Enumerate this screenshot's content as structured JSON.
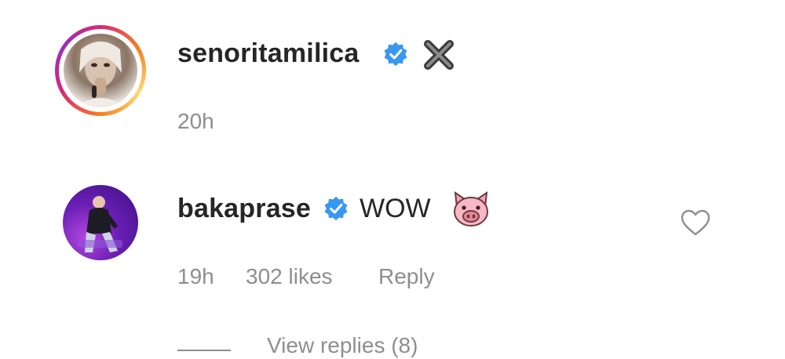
{
  "comments": [
    {
      "username": "senoritamilica",
      "verified": true,
      "text_icon": "heavy-multiplication-x-emoji",
      "time": "20h"
    },
    {
      "username": "bakaprase",
      "verified": true,
      "text": "WOW",
      "text_icon": "pig-face-emoji",
      "time": "19h",
      "likes": "302 likes",
      "reply_label": "Reply"
    }
  ],
  "view_replies": "View replies (8)",
  "colors": {
    "verified_blue": "#3897f0",
    "muted_text": "#8e8e8e",
    "primary_text": "#262626"
  }
}
